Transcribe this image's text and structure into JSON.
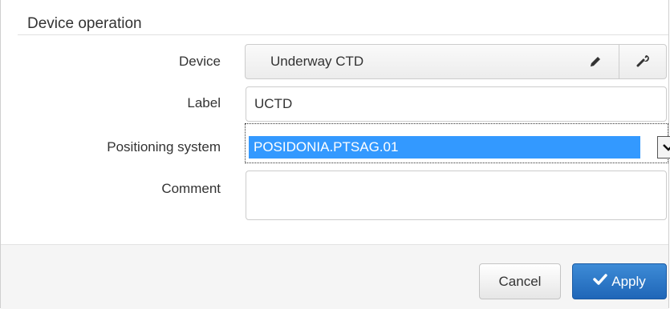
{
  "dialog": {
    "title": "Device operation",
    "device": {
      "label": "Device",
      "value": "Underway CTD",
      "edit_icon": "pencil-icon",
      "tool_icon": "wrench-icon"
    },
    "label_field": {
      "label": "Label",
      "value": "UCTD"
    },
    "positioning": {
      "label": "Positioning system",
      "selected": "POSIDONIA.PTSAG.01",
      "arrow_icon": "chevron-down-icon"
    },
    "comment": {
      "label": "Comment",
      "value": ""
    },
    "buttons": {
      "cancel": "Cancel",
      "apply": "Apply",
      "apply_icon": "checkmark-icon"
    },
    "colors": {
      "primary": "#2a74c4",
      "selection": "#3399ff"
    }
  }
}
